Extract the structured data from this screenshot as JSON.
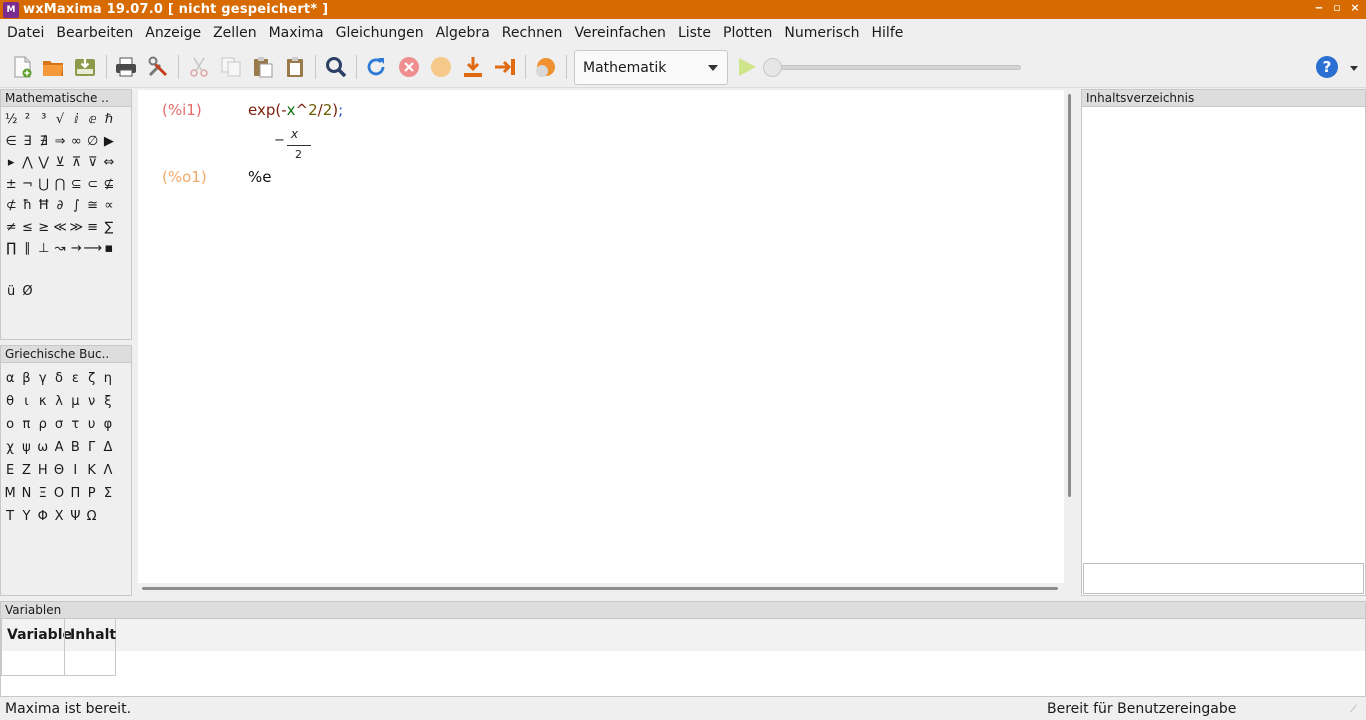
{
  "window": {
    "title": "wxMaxima 19.07.0 [ nicht gespeichert* ]",
    "controls": [
      "‒",
      "▫",
      "×"
    ]
  },
  "menu": [
    "Datei",
    "Bearbeiten",
    "Anzeige",
    "Zellen",
    "Maxima",
    "Gleichungen",
    "Algebra",
    "Rechnen",
    "Vereinfachen",
    "Liste",
    "Plotten",
    "Numerisch",
    "Hilfe"
  ],
  "toolbar": {
    "buttons": [
      "new-file-icon",
      "open-folder-icon",
      "save-icon",
      "print-icon",
      "preferences-icon",
      "cut-icon",
      "copy-icon",
      "paste-icon",
      "paste-special-icon",
      "find-icon",
      "restart-icon",
      "interrupt-icon",
      "follow-icon",
      "evaluate-icon",
      "evaluate-all-icon",
      "animation-icon"
    ],
    "mode_select": "Mathematik",
    "help": "?"
  },
  "math_panel": {
    "title": "Mathematische ..",
    "symbols": [
      "½",
      "²",
      "³",
      "√",
      "ⅈ",
      "ⅇ",
      "ℏ",
      "∈",
      "∃",
      "∄",
      "⇒",
      "∞",
      "∅",
      "▶",
      "▸",
      "⋀",
      "⋁",
      "⊻",
      "⊼",
      "⊽",
      "⇔",
      "±",
      "¬",
      "⋃",
      "⋂",
      "⊆",
      "⊂",
      "⊈",
      "⊄",
      "ħ",
      "Ħ",
      "∂",
      "∫",
      "≅",
      "∝",
      "≠",
      "≤",
      "≥",
      "≪",
      "≫",
      "≡",
      "∑",
      "∏",
      "∥",
      "⊥",
      "↝",
      "→",
      "⟶",
      "▪",
      "",
      "",
      "",
      "",
      "",
      "",
      "",
      "ü",
      "Ø"
    ]
  },
  "greek_panel": {
    "title": "Griechische Buc..",
    "letters": [
      "α",
      "β",
      "γ",
      "δ",
      "ε",
      "ζ",
      "η",
      "θ",
      "ι",
      "κ",
      "λ",
      "μ",
      "ν",
      "ξ",
      "ο",
      "π",
      "ρ",
      "σ",
      "τ",
      "υ",
      "φ",
      "χ",
      "ψ",
      "ω",
      "Α",
      "Β",
      "Γ",
      "Δ",
      "Ε",
      "Ζ",
      "Η",
      "Θ",
      "Ι",
      "Κ",
      "Λ",
      "Μ",
      "Ν",
      "Ξ",
      "Ο",
      "Π",
      "Ρ",
      "Σ",
      "Τ",
      "Υ",
      "Φ",
      "Χ",
      "Ψ",
      "Ω"
    ]
  },
  "worksheet": {
    "input_label": "(%i1)",
    "input": {
      "fn": "exp(",
      "minus": "-",
      "var": "x",
      "pow": "^",
      "two": "2",
      "div": "/",
      "two2": "2",
      "close": ")",
      "semi": ";"
    },
    "output_label": "(%o1)",
    "output": {
      "exp_minus": "−",
      "exp_num": "x",
      "exp_den": "2",
      "base": "%e"
    }
  },
  "toc": {
    "title": "Inhaltsverzeichnis",
    "search_value": ""
  },
  "variables": {
    "title": "Variablen",
    "columns": [
      "Variable",
      "Inhalt"
    ],
    "rows": []
  },
  "status": {
    "left": "Maxima ist bereit.",
    "right": "Bereit für Benutzereingabe"
  },
  "colors": {
    "titlebar": "#d76a00",
    "input_label": "#e56b6b",
    "output_label": "#f2a96a"
  }
}
